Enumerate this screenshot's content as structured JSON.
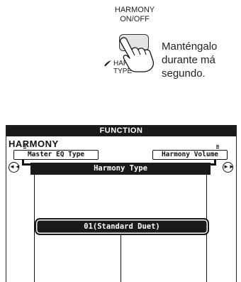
{
  "button": {
    "caption_line1": "HARMONY",
    "caption_line2": "ON/OFF",
    "secondary_label_line1": "HARMONY",
    "secondary_label_line2": "TYPE"
  },
  "instruction": {
    "line1": "Manténgalo",
    "line2": "durante má",
    "line3": "segundo."
  },
  "display": {
    "header": "FUNCTION",
    "title": "HARMONY",
    "tab_left": "Master EQ Type",
    "tab_right": "Harmony Volume",
    "nav_left": "◄◄",
    "nav_right": "►►",
    "section": "Harmony Type",
    "value": "01(Standard Duet)"
  }
}
